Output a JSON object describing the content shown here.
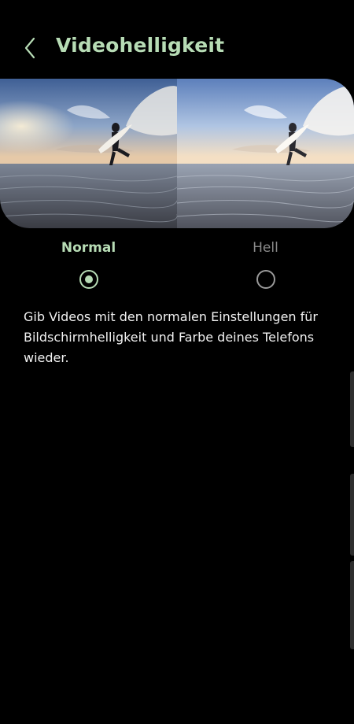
{
  "theme": {
    "accent": "#b7dcb5",
    "background": "#000000",
    "text": "#ffffff",
    "muted": "#8a8a8a"
  },
  "header": {
    "back_icon": "chevron-left-icon",
    "title": "Videohelligkeit"
  },
  "preview": {
    "panels": [
      "Normal",
      "Hell"
    ]
  },
  "options": [
    {
      "label": "Normal",
      "selected": true
    },
    {
      "label": "Hell",
      "selected": false
    }
  ],
  "description": "Gib Videos mit den normalen Einstellungen für Bildschirmhelligkeit und Farbe deines Telefons wieder."
}
